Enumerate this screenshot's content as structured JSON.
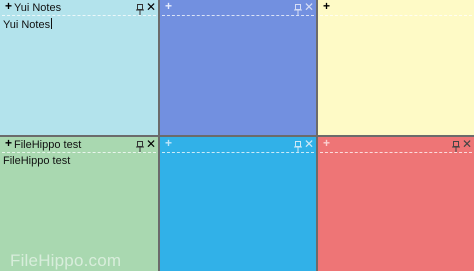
{
  "notes": [
    {
      "title": "Yui Notes",
      "content": "Yui Notes",
      "color": "#b3e3ec",
      "focused": true
    },
    {
      "title": "",
      "content": "",
      "color": "#7290e0",
      "focused": false
    },
    {
      "title": "",
      "content": "",
      "color": "#fefac6",
      "focused": false
    },
    {
      "title": "FileHippo test",
      "content": "FileHippo test",
      "color": "#a9d8b0",
      "focused": false
    },
    {
      "title": "",
      "content": "",
      "color": "#31b1e8",
      "focused": false
    },
    {
      "title": "",
      "content": "",
      "color": "#ee7576",
      "focused": false
    }
  ],
  "icons": {
    "add": "+",
    "close": "✕",
    "pin": "pin-icon"
  },
  "watermark": "FileHippo.com"
}
